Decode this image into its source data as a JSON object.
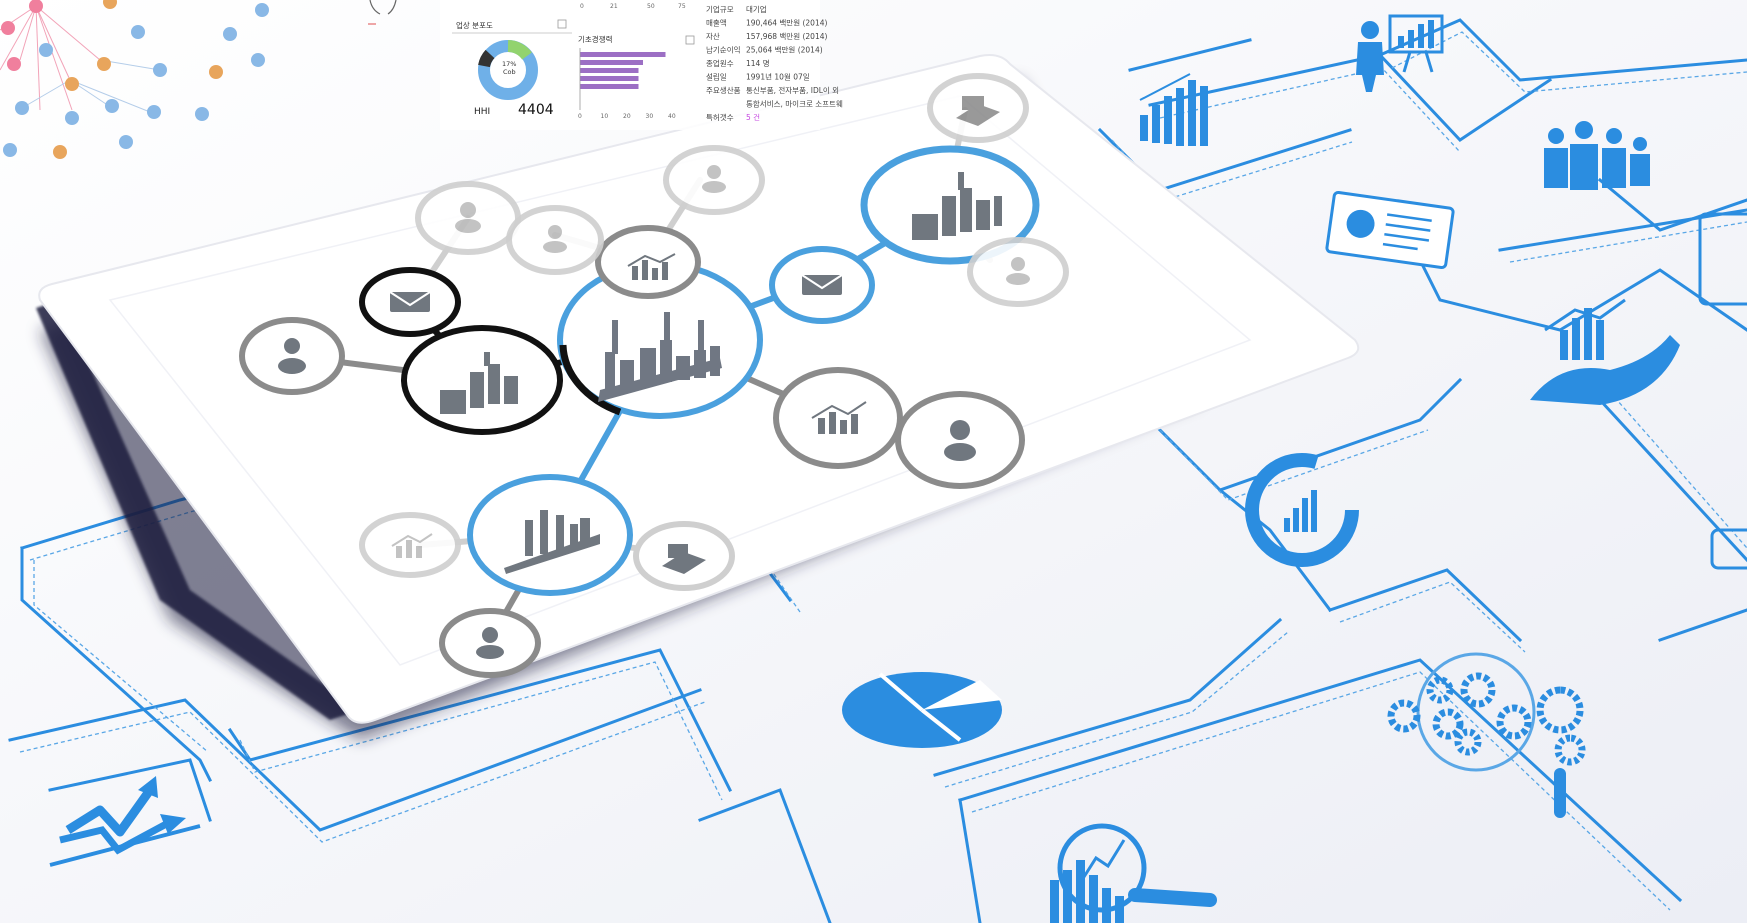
{
  "colors": {
    "accent_blue": "#1d83d6",
    "light_blue": "#4aa0de",
    "gray_circle": "#8b8b8b",
    "light_gray_circle": "#cfcfcf",
    "black_circle": "#111111",
    "paper": "#f6f7fb",
    "tablet_screen": "#ffffff",
    "network_pink": "#f07f9d",
    "network_orange": "#e8a55c",
    "network_blue": "#89b8e6",
    "donut_green": "#92d36e",
    "bar_purple": "#9c6fc4",
    "link_magenta": "#c548e0"
  },
  "dashboard": {
    "top_axis_ticks": [
      "0",
      "21",
      "50",
      "75"
    ],
    "donut_panel": {
      "title": "업상 분포도",
      "center_label_line1": "17%",
      "center_label_line2": "Cob",
      "hhi_label": "HHI",
      "hhi_value": "4404"
    },
    "bar_panel": {
      "title": "기초경쟁력",
      "values": [
        38,
        28,
        26,
        26,
        26
      ],
      "axis_ticks": [
        "0",
        "10",
        "20",
        "30",
        "40"
      ],
      "xlim": [
        0,
        40
      ]
    },
    "info_table": [
      {
        "label": "기업규모",
        "value": "대기업"
      },
      {
        "label": "매출액",
        "value": "190,464 백만원 (2014)"
      },
      {
        "label": "자산",
        "value": "157,968 백만원 (2014)"
      },
      {
        "label": "납기순이익",
        "value": "25,064 백만원 (2014)"
      },
      {
        "label": "종업원수",
        "value": "114 명"
      },
      {
        "label": "설립일",
        "value": "1991년 10월 07일"
      },
      {
        "label": "주요생산품",
        "value": "통신부품, 전자부품, IDL이 외"
      },
      {
        "label": "",
        "value": "통합서비스, 마이크로 소프트웨"
      },
      {
        "label": "특허갯수",
        "value": "5 건"
      }
    ]
  },
  "network_graph": {
    "center_node": "factory-icon",
    "nodes": [
      {
        "kind": "factory",
        "style": "black"
      },
      {
        "kind": "factory",
        "style": "blue"
      },
      {
        "kind": "factory",
        "style": "blue"
      },
      {
        "kind": "envelope",
        "style": "black"
      },
      {
        "kind": "envelope",
        "style": "blue"
      },
      {
        "kind": "person",
        "style": "gray"
      },
      {
        "kind": "person",
        "style": "gray"
      },
      {
        "kind": "person",
        "style": "gray"
      },
      {
        "kind": "person",
        "style": "light"
      },
      {
        "kind": "person",
        "style": "light"
      },
      {
        "kind": "person",
        "style": "light"
      },
      {
        "kind": "person",
        "style": "light"
      },
      {
        "kind": "chart",
        "style": "gray"
      },
      {
        "kind": "chart",
        "style": "gray"
      },
      {
        "kind": "chart",
        "style": "light"
      },
      {
        "kind": "warehouse",
        "style": "light"
      },
      {
        "kind": "warehouse",
        "style": "gray"
      }
    ]
  },
  "blueprint_icons": [
    "presenter-icon",
    "bar-chart-icon",
    "team-icon",
    "report-clipboard-icon",
    "hand-chart-icon",
    "donut-chart-icon",
    "pie-chart-icon",
    "gears-icon",
    "magnifier-analytics-icon",
    "trend-arrow-icon"
  ]
}
